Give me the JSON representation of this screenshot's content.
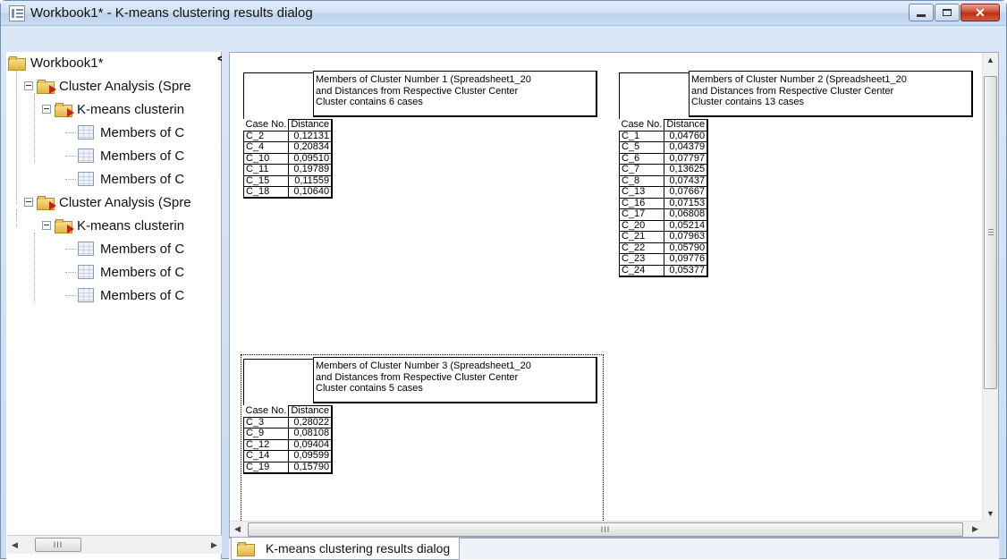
{
  "window": {
    "title": "Workbook1* - K-means clustering results dialog",
    "buttons": {
      "minimize": "",
      "maximize": "",
      "close": "✕"
    }
  },
  "tree": {
    "collapse_glyph": "<",
    "root": "Workbook1*",
    "items": [
      {
        "label": "Cluster Analysis (Spre",
        "level": 1
      },
      {
        "label": "K-means clusterin",
        "level": 2
      },
      {
        "label": "Members of C",
        "level": 3
      },
      {
        "label": "Members of C",
        "level": 3
      },
      {
        "label": "Members of C",
        "level": 3
      },
      {
        "label": "Cluster Analysis (Spre",
        "level": 1
      },
      {
        "label": "K-means clusterin",
        "level": 2
      },
      {
        "label": "Members of C",
        "level": 3
      },
      {
        "label": "Members of C",
        "level": 3
      },
      {
        "label": "Members of C",
        "level": 3
      }
    ]
  },
  "scroll": {
    "grip": "III",
    "left": "◀",
    "right": "▶",
    "up": "▲",
    "down": "▼"
  },
  "results": [
    {
      "header": [
        "Members of Cluster Number 1 (Spreadsheet1_20",
        "and Distances from Respective Cluster Center",
        "Cluster contains 6 cases"
      ],
      "col_case": "Case No.",
      "col_distance": "Distance",
      "rows": [
        [
          "C_2",
          "0,12131"
        ],
        [
          "C_4",
          "0,20834"
        ],
        [
          "C_10",
          "0,09510"
        ],
        [
          "C_11",
          "0,19789"
        ],
        [
          "C_15",
          "0,11559"
        ],
        [
          "C_18",
          "0,10640"
        ]
      ]
    },
    {
      "header": [
        "Members of Cluster Number 2 (Spreadsheet1_20",
        "and Distances from Respective Cluster Center",
        "Cluster contains 13 cases"
      ],
      "col_case": "Case No.",
      "col_distance": "Distance",
      "rows": [
        [
          "C_1",
          "0,04760"
        ],
        [
          "C_5",
          "0,04379"
        ],
        [
          "C_6",
          "0,07797"
        ],
        [
          "C_7",
          "0,13625"
        ],
        [
          "C_8",
          "0,07437"
        ],
        [
          "C_13",
          "0,07667"
        ],
        [
          "C_16",
          "0,07153"
        ],
        [
          "C_17",
          "0,06808"
        ],
        [
          "C_20",
          "0,05214"
        ],
        [
          "C_21",
          "0,07963"
        ],
        [
          "C_22",
          "0,05790"
        ],
        [
          "C_23",
          "0,09776"
        ],
        [
          "C_24",
          "0,05377"
        ]
      ]
    },
    {
      "header": [
        "Members of Cluster Number 3 (Spreadsheet1_20",
        "and Distances from Respective Cluster Center",
        "Cluster contains 5 cases"
      ],
      "col_case": "Case No.",
      "col_distance": "Distance",
      "rows": [
        [
          "C_3",
          "0,28022"
        ],
        [
          "C_9",
          "0,08108"
        ],
        [
          "C_12",
          "0,09404"
        ],
        [
          "C_14",
          "0,09599"
        ],
        [
          "C_19",
          "0,15790"
        ]
      ]
    }
  ],
  "bottom_tab": {
    "label": "K-means clustering results dialog"
  }
}
